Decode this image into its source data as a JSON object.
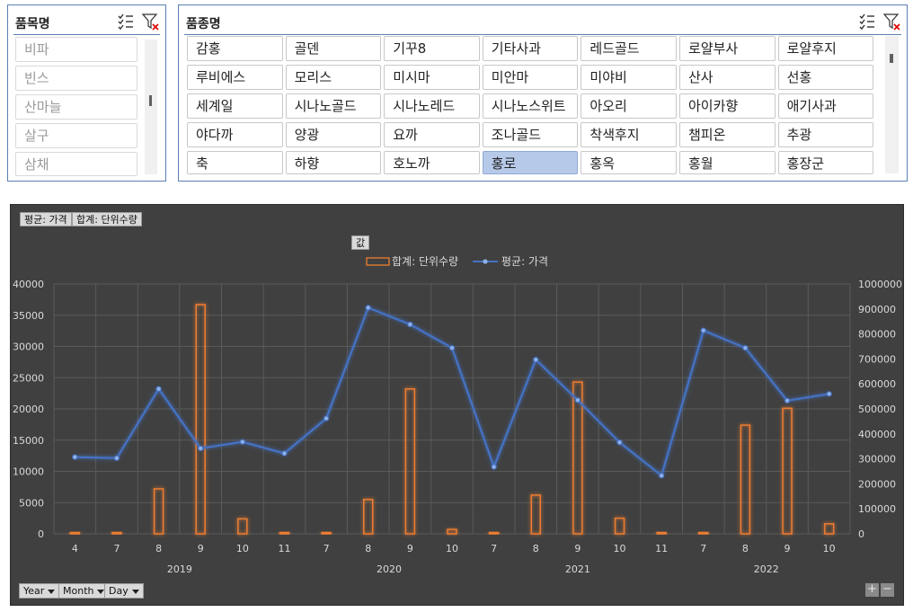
{
  "slicer_item": {
    "title": "품목명",
    "items": [
      "비파",
      "빈스",
      "산마늘",
      "살구",
      "삼채"
    ]
  },
  "slicer_variety": {
    "title": "품종명",
    "items": [
      "감홍",
      "골덴",
      "기꾸8",
      "기타사과",
      "레드골드",
      "로얄부사",
      "로얄후지",
      "루비에스",
      "모리스",
      "미시마",
      "미안마",
      "미야비",
      "산사",
      "선홍",
      "세계일",
      "시나노골드",
      "시나노레드",
      "시나노스위트",
      "아오리",
      "아이카향",
      "애기사과",
      "야다까",
      "양광",
      "요까",
      "조나골드",
      "착색후지",
      "챔피온",
      "추광",
      "축",
      "하향",
      "호노까",
      "홍로",
      "홍옥",
      "홍월",
      "홍장군"
    ],
    "selected": "홍로"
  },
  "colors": {
    "bar": "#ed7d31",
    "line": "#4472c4",
    "chart_bg": "#404040",
    "slicer_border": "#5b7fb3",
    "selected": "#b7c9e8"
  },
  "chart_fields": {
    "filter_avg": "평균: 가격",
    "filter_sum": "합계: 단위수량",
    "values_btn": "값"
  },
  "axis_buttons": [
    "Year",
    "Month",
    "Day"
  ],
  "zoom": {
    "plus": "+",
    "minus": "−"
  },
  "chart_data": {
    "type": "bar",
    "legend": [
      "합계: 단위수량",
      "평균: 가격"
    ],
    "legend_position": "top",
    "grid": true,
    "x_years": [
      {
        "year": "2019",
        "months": [
          "4",
          "7",
          "8",
          "9",
          "10",
          "11"
        ]
      },
      {
        "year": "2020",
        "months": [
          "7",
          "8",
          "9",
          "10"
        ]
      },
      {
        "year": "2021",
        "months": [
          "7",
          "8",
          "9",
          "10",
          "11"
        ]
      },
      {
        "year": "2022",
        "months": [
          "7",
          "8",
          "9",
          "10"
        ]
      }
    ],
    "categories": [
      "4",
      "7",
      "8",
      "9",
      "10",
      "11",
      "7",
      "8",
      "9",
      "10",
      "7",
      "8",
      "9",
      "10",
      "11",
      "7",
      "8",
      "9",
      "10"
    ],
    "series": [
      {
        "name": "합계: 단위수량",
        "type": "bar",
        "axis": "left",
        "values": [
          200,
          200,
          7200,
          36700,
          2400,
          200,
          200,
          5500,
          23200,
          700,
          200,
          6200,
          24300,
          2500,
          200,
          200,
          17400,
          20100,
          1600
        ]
      },
      {
        "name": "평균: 가격",
        "type": "line",
        "axis": "right",
        "values": [
          307000,
          303000,
          580000,
          342000,
          368000,
          322000,
          462000,
          905000,
          838000,
          744000,
          268000,
          697000,
          535000,
          366000,
          233000,
          814000,
          744000,
          533000,
          560000
        ]
      }
    ],
    "y_left": {
      "min": 0,
      "max": 40000,
      "ticks": [
        "0",
        "5000",
        "10000",
        "15000",
        "20000",
        "25000",
        "30000",
        "35000",
        "40000"
      ]
    },
    "y_right": {
      "min": 0,
      "max": 1000000,
      "ticks": [
        "0",
        "100000",
        "200000",
        "300000",
        "400000",
        "500000",
        "600000",
        "700000",
        "800000",
        "900000",
        "1000000"
      ]
    }
  }
}
